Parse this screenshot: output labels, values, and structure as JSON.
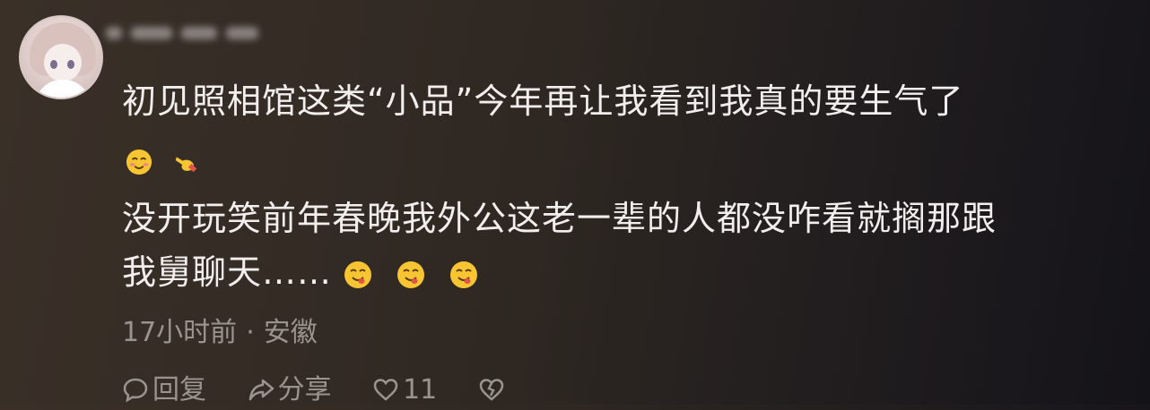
{
  "comment": {
    "text_line1": "初见照相馆这类“小品”今年再让我看到我真的要生气了",
    "text_line2": "没开玩笑前年春晚我外公这老一辈的人都没咋看就搁那跟",
    "text_line3": "我舅聊天……",
    "emojis_row1": [
      "flushed-smile-emoji",
      "pointing-hand-emoji"
    ],
    "emojis_line3": [
      "yum-face-emoji",
      "yum-face-emoji",
      "yum-face-emoji"
    ],
    "time": "17小时前",
    "separator": "·",
    "location": "安徽"
  },
  "actions": {
    "reply_label": "回复",
    "share_label": "分享",
    "like_count": "11"
  },
  "colors": {
    "text": "#f2eeee",
    "meta": "#9a9491",
    "emoji_yellow": "#f7c531"
  }
}
